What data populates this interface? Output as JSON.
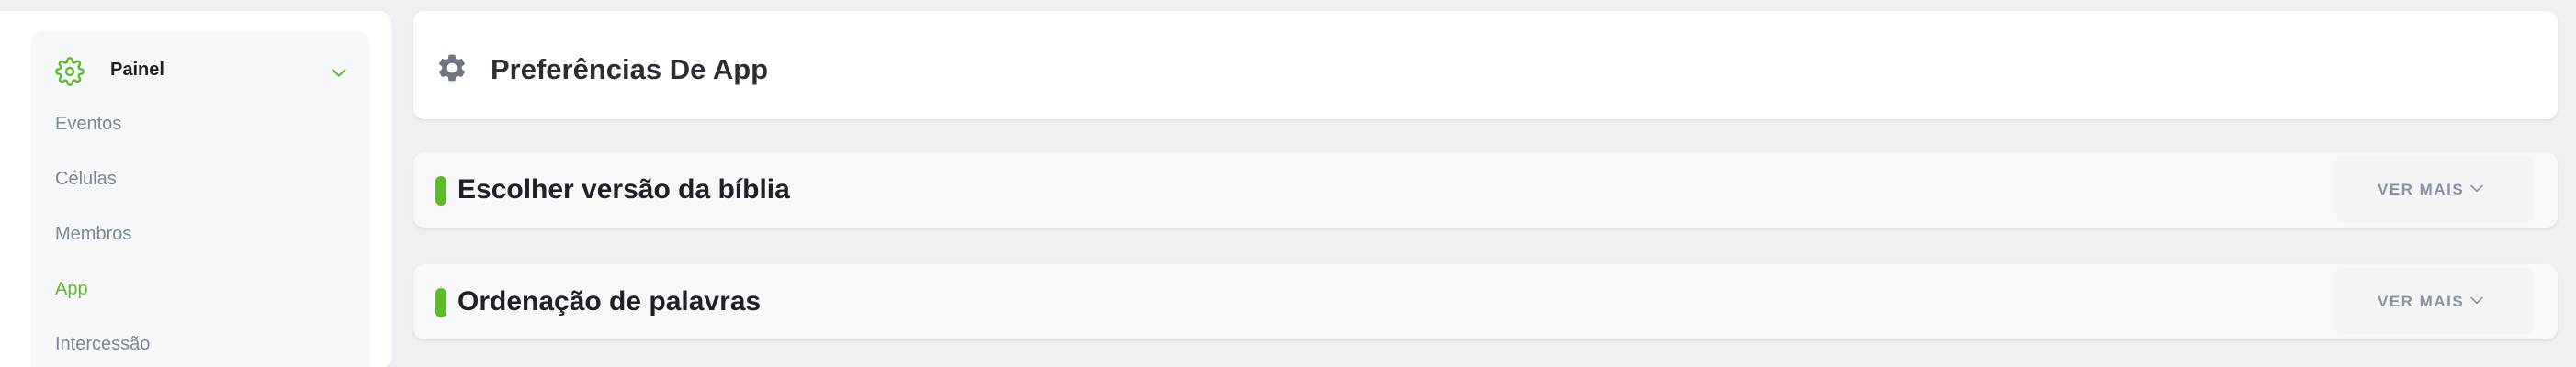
{
  "sidebar": {
    "group": {
      "title": "Painel",
      "icon": "gear-icon",
      "expanded": true
    },
    "items": [
      {
        "label": "Eventos",
        "active": false
      },
      {
        "label": "Células",
        "active": false
      },
      {
        "label": "Membros",
        "active": false
      },
      {
        "label": "App",
        "active": true
      },
      {
        "label": "Intercessão",
        "active": false
      }
    ]
  },
  "main": {
    "header": {
      "title": "Preferências De App",
      "icon": "gear-icon"
    },
    "sections": [
      {
        "title": "Escolher versão da bíblia",
        "more_label": "VER MAIS"
      },
      {
        "title": "Ordenação de palavras",
        "more_label": "VER MAIS"
      }
    ]
  },
  "colors": {
    "accent": "#5dbb2d",
    "background": "#eef0f4",
    "muted_text": "#7b8794"
  }
}
